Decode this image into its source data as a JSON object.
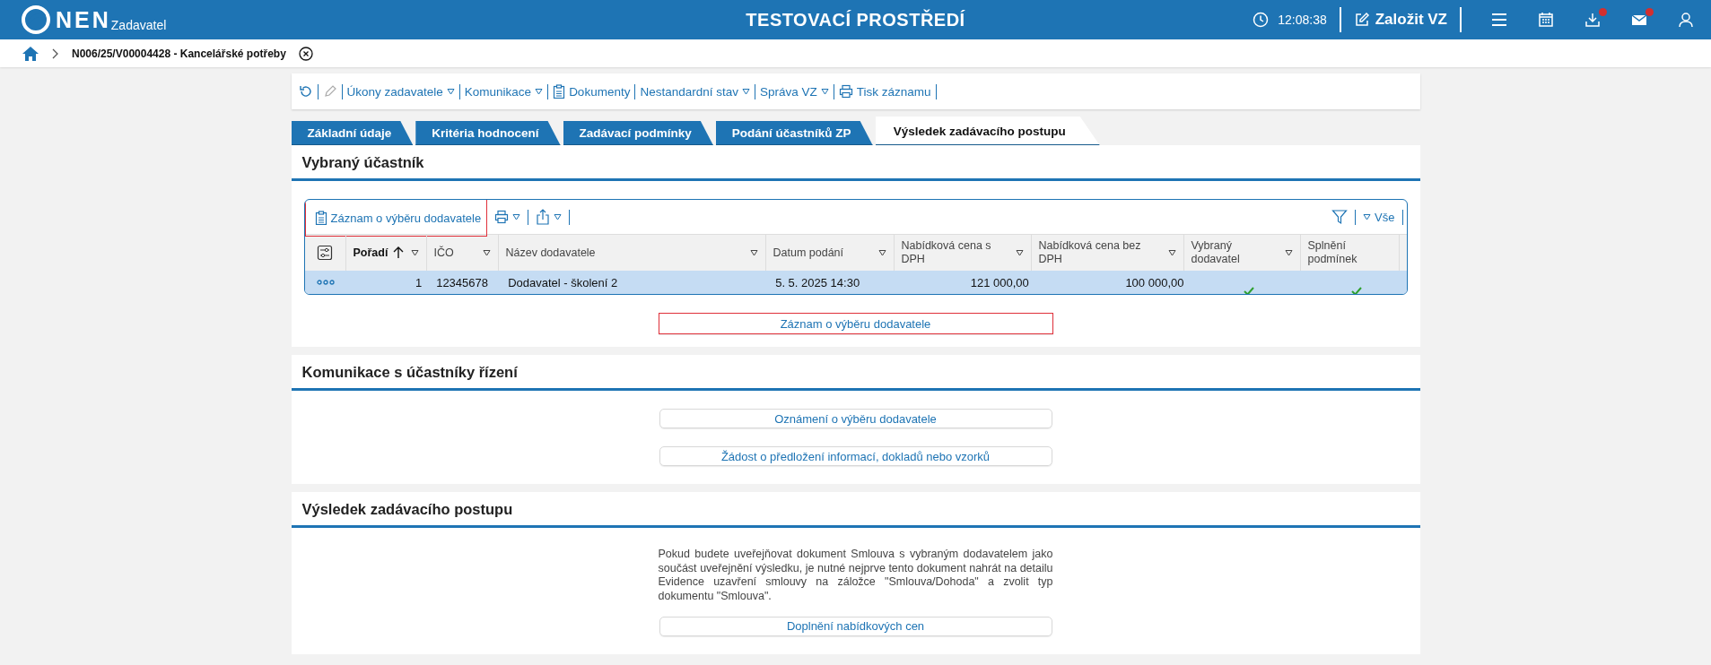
{
  "header": {
    "logo": "NEN",
    "logo_sub": "Zadavatel",
    "title": "TESTOVACÍ PROSTŘEDÍ",
    "time": "12:08:38",
    "create_button": "Založit VZ",
    "icons": [
      {
        "kind": "menu",
        "badge": false
      },
      {
        "kind": "calendar",
        "badge": false
      },
      {
        "kind": "download",
        "badge": true
      },
      {
        "kind": "mail",
        "badge": true
      },
      {
        "kind": "user",
        "badge": false
      }
    ]
  },
  "breadcrumb": {
    "title": "N006/25/V00004428 - Kancelářské potřeby"
  },
  "toolbar": [
    {
      "kind": "refresh",
      "disabled": false
    },
    {
      "kind": "edit",
      "disabled": true
    },
    {
      "kind": "menu",
      "label": "Úkony zadavatele",
      "dropdown": true
    },
    {
      "kind": "menu",
      "label": "Komunikace",
      "dropdown": true
    },
    {
      "kind": "doc",
      "label": "Dokumenty",
      "dropdown": false
    },
    {
      "kind": "menu",
      "label": "Nestandardní stav",
      "dropdown": true
    },
    {
      "kind": "menu",
      "label": "Správa VZ",
      "dropdown": true
    },
    {
      "kind": "print",
      "label": "Tisk záznamu",
      "dropdown": false
    }
  ],
  "tabs": [
    {
      "label": "Základní údaje",
      "selected": false
    },
    {
      "label": "Kritéria hodnocení",
      "selected": false
    },
    {
      "label": "Zadávací podmínky",
      "selected": false
    },
    {
      "label": "Podání účastníků ZP",
      "selected": false
    },
    {
      "label": "Výsledek zadávacího postupu",
      "selected": true
    }
  ],
  "selected_participant": {
    "title": "Vybraný účastník",
    "table_action": "Záznam o výběru dodavatele",
    "filter_label": "Vše",
    "columns": [
      {
        "label": "Pořadí",
        "sorted": true
      },
      {
        "label": "IČO",
        "sorted": false
      },
      {
        "label": "Název dodavatele",
        "sorted": false
      },
      {
        "label": "Datum podání",
        "sorted": false
      },
      {
        "label": "Nabídková cena s DPH",
        "sorted": false
      },
      {
        "label": "Nabídková cena bez DPH",
        "sorted": false
      },
      {
        "label": "Vybraný dodavatel",
        "sorted": false
      },
      {
        "label": "Splnění podmínek",
        "sorted": false
      }
    ],
    "rows": [
      {
        "selected": true,
        "order": "1",
        "ico": "12345678",
        "name": "Dodavatel - školení 2",
        "date": "5. 5. 2025 14:30",
        "price_vat": "121 000,00",
        "price_novat": "100 000,00",
        "chosen": true,
        "conditions_met": true
      }
    ],
    "button": "Záznam o výběru dodavatele"
  },
  "communication": {
    "title": "Komunikace s účastníky řízení",
    "buttons": [
      "Oznámení o výběru dodavatele",
      "Žádost o předložení informací, dokladů nebo vzorků"
    ]
  },
  "result": {
    "title": "Výsledek zadávacího postupu",
    "note": "Pokud budete uveřejňovat dokument Smlouva s vybraným dodavatelem jako součást uveřejnění výsledku, je nutné nejprve tento dokument nahrát na detailu Evidence uzavření smlouvy na záložce \"Smlouva/Dohoda\" a zvolit typ dokumentu \"Smlouva\".",
    "button": "Doplnění nabídkových cen"
  }
}
